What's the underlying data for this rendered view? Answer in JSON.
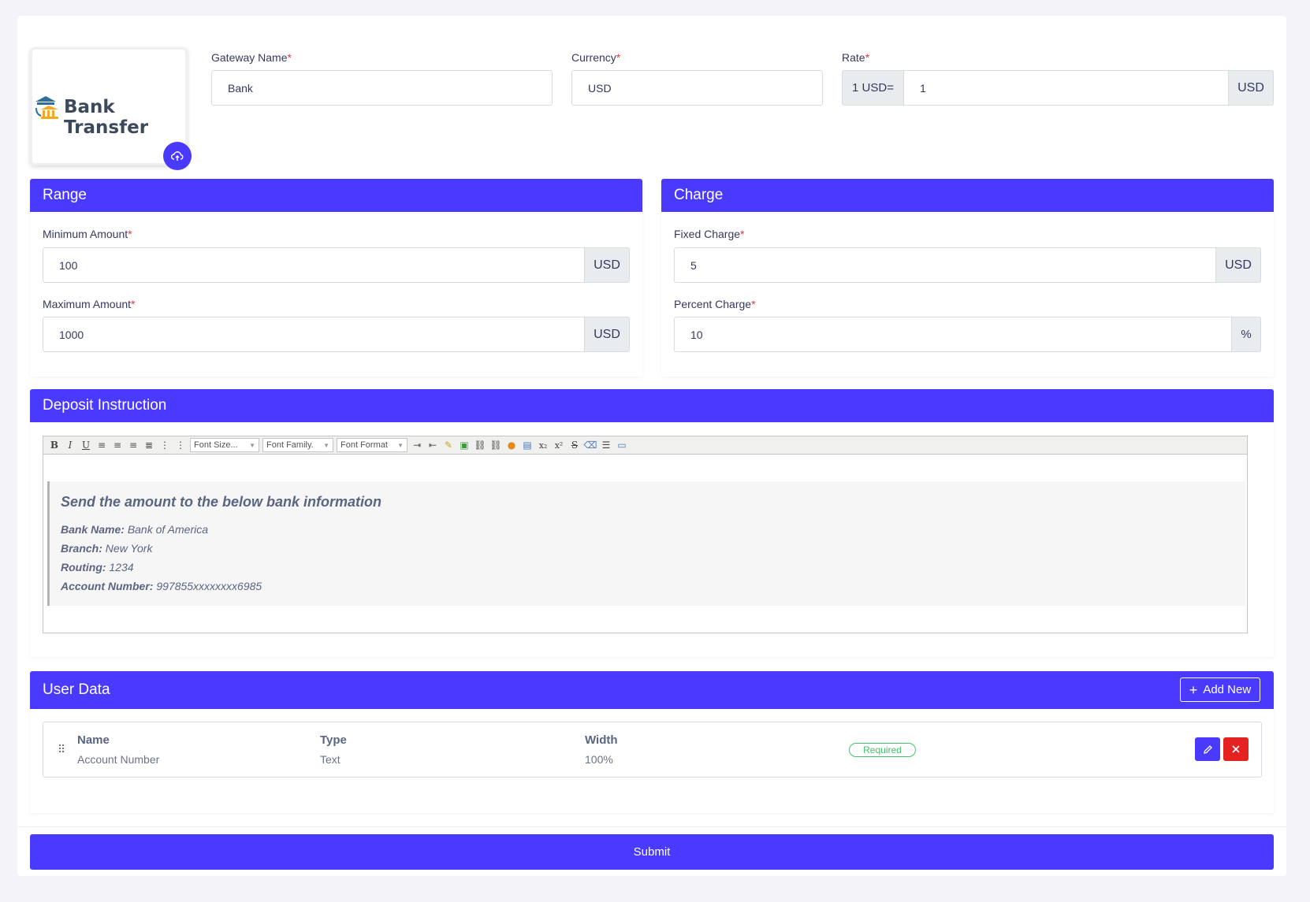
{
  "logo": {
    "text": "Bank Transfer"
  },
  "gateway": {
    "name_label": "Gateway Name",
    "name_value": "Bank",
    "currency_label": "Currency",
    "currency_value": "USD",
    "rate_label": "Rate",
    "rate_prefix": "1 USD=",
    "rate_value": "1",
    "rate_suffix": "USD",
    "required_mark": "*"
  },
  "range": {
    "title": "Range",
    "min_label": "Minimum Amount",
    "min_value": "100",
    "min_suffix": "USD",
    "max_label": "Maximum Amount",
    "max_value": "1000",
    "max_suffix": "USD"
  },
  "charge": {
    "title": "Charge",
    "fixed_label": "Fixed Charge",
    "fixed_value": "5",
    "fixed_suffix": "USD",
    "percent_label": "Percent Charge",
    "percent_value": "10",
    "percent_suffix": "%"
  },
  "deposit": {
    "title": "Deposit Instruction",
    "toolbar": {
      "font_size": "Font Size...",
      "font_family": "Font Family.",
      "font_format": "Font Format"
    },
    "content": {
      "heading": "Send the amount to the below bank information",
      "lines": [
        {
          "label": "Bank Name:",
          "value": "Bank of America"
        },
        {
          "label": "Branch:",
          "value": "New York"
        },
        {
          "label": "Routing:",
          "value": "1234"
        },
        {
          "label": "Account Number:",
          "value": "997855xxxxxxxx6985"
        }
      ]
    }
  },
  "user_data": {
    "title": "User Data",
    "add_new_label": "Add New",
    "rows": [
      {
        "name_header": "Name",
        "name_value": "Account Number",
        "type_header": "Type",
        "type_value": "Text",
        "width_header": "Width",
        "width_value": "100%",
        "badge": "Required"
      }
    ]
  },
  "submit_label": "Submit",
  "colors": {
    "primary": "#4a3aff",
    "danger": "#e52222",
    "success": "#44c26b"
  }
}
